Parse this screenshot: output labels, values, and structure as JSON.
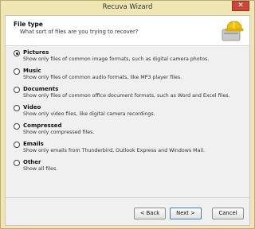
{
  "window": {
    "title": "Recuva Wizard",
    "close_glyph": "✕"
  },
  "header": {
    "title": "File type",
    "subtitle": "What sort of files are you trying to recover?",
    "logo_icon": "recuva-hardhat-drive-icon"
  },
  "options": [
    {
      "label": "Pictures",
      "description": "Show only files of common image formats, such as digital camera photos.",
      "selected": true
    },
    {
      "label": "Music",
      "description": "Show only files of common audio formats, like MP3 player files.",
      "selected": false
    },
    {
      "label": "Documents",
      "description": "Show only files of common office document formats, such as Word and Excel files.",
      "selected": false
    },
    {
      "label": "Video",
      "description": "Show only video files, like digital camera recordings.",
      "selected": false
    },
    {
      "label": "Compressed",
      "description": "Show only compressed files.",
      "selected": false
    },
    {
      "label": "Emails",
      "description": "Show only emails from Thunderbird, Outlook Express and Windows Mail.",
      "selected": false
    },
    {
      "label": "Other",
      "description": "Show all files.",
      "selected": false
    }
  ],
  "buttons": {
    "back": "< Back",
    "next": "Next >",
    "cancel": "Cancel"
  }
}
